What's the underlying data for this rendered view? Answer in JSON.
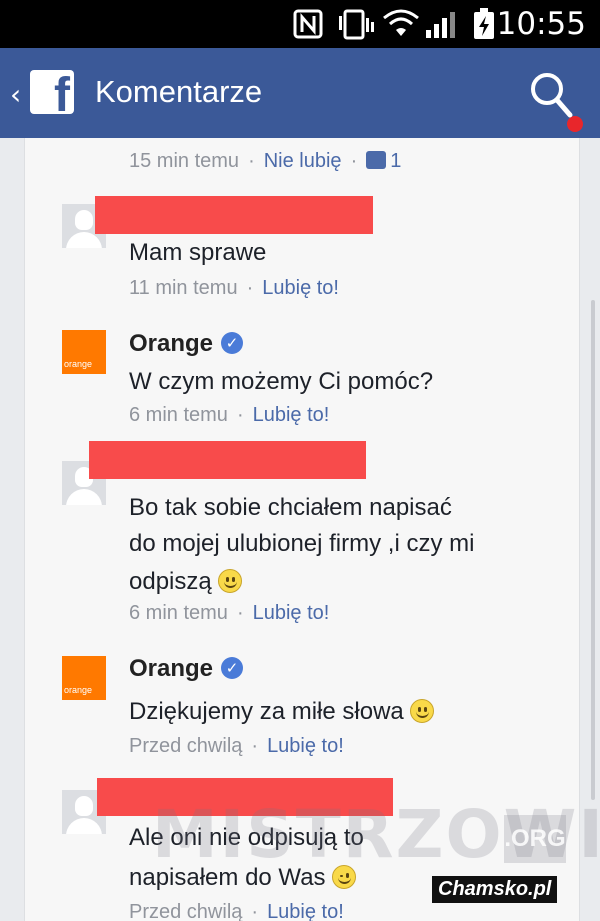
{
  "status_bar": {
    "time": "10:55"
  },
  "app_bar": {
    "title": "Komentarze",
    "back_glyph": "‹"
  },
  "comments": [
    {
      "meta_time": "15 min temu",
      "like_label": "Nie lubię",
      "like_count": "1"
    },
    {
      "text": "Mam sprawe",
      "meta_time": "11 min temu",
      "like_label": "Lubię to!"
    },
    {
      "author": "Orange",
      "verified": true,
      "avatar_text": "orange",
      "text": "W czym możemy Ci pomóc?",
      "meta_time": "6 min temu",
      "like_label": "Lubię to!"
    },
    {
      "text_lines": [
        "Bo tak sobie chciałem napisać",
        "do mojej ulubionej firmy ,i czy mi",
        "odpiszą"
      ],
      "emoji": "smile",
      "meta_time": "6 min temu",
      "like_label": "Lubię to!"
    },
    {
      "author": "Orange",
      "verified": true,
      "avatar_text": "orange",
      "text": "Dziękujemy za miłe słowa",
      "emoji": "smile",
      "meta_time": "Przed chwilą",
      "like_label": "Lubię to!"
    },
    {
      "text_lines": [
        "Ale oni nie odpisują to",
        "napisałem do Was"
      ],
      "emoji": "wink",
      "meta_time": "Przed chwilą",
      "like_label": "Lubię to!"
    }
  ],
  "watermark": {
    "main": "MISTRZOWIE",
    "suffix": ".ORG",
    "credit": "Chamsko.pl"
  },
  "colors": {
    "facebook_blue": "#3b5998",
    "orange_brand": "#ff7900",
    "redaction": "#f84b4b",
    "notification_dot": "#e8262b"
  },
  "icons": [
    "nfc-icon",
    "vibrate-icon",
    "wifi-icon",
    "signal-icon",
    "battery-icon",
    "facebook-logo-icon",
    "search-icon",
    "thumbs-up-icon",
    "smiley-icon",
    "verified-badge-icon"
  ]
}
